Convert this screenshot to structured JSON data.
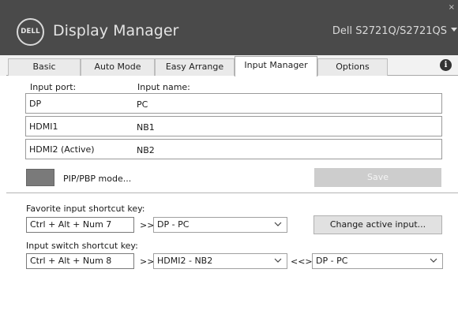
{
  "header": {
    "logo_text": "DELL",
    "app_title": "Display Manager",
    "monitor": "Dell S2721Q/S2721QS",
    "close": "×"
  },
  "tabs": [
    {
      "label": "Basic",
      "active": false
    },
    {
      "label": "Auto Mode",
      "active": false
    },
    {
      "label": "Easy Arrange",
      "active": false
    },
    {
      "label": "Input Manager",
      "active": true
    },
    {
      "label": "Options",
      "active": false
    }
  ],
  "info_icon": "i",
  "input_manager": {
    "port_header": "Input port:",
    "name_header": "Input name:",
    "rows": [
      {
        "port": "DP",
        "name": "PC"
      },
      {
        "port": "HDMI1",
        "name": "NB1"
      },
      {
        "port": "HDMI2 (Active)",
        "name": "NB2"
      }
    ],
    "pip_label": "PIP/PBP mode...",
    "save_label": "Save"
  },
  "favorite": {
    "label": "Favorite input shortcut key:",
    "shortcut": "Ctrl + Alt + Num 7",
    "arrow": ">>",
    "selected": "DP - PC",
    "change_button": "Change active input..."
  },
  "switch": {
    "label": "Input switch shortcut key:",
    "shortcut": "Ctrl + Alt + Num 8",
    "arrow": ">>",
    "selected_a": "HDMI2 - NB2",
    "swap": "<<>>",
    "selected_b": "DP - PC"
  },
  "colors": {
    "header_bg": "#4a4a4a",
    "header_text": "#e3e3e3",
    "disabled_button": "#cdcdcd"
  }
}
